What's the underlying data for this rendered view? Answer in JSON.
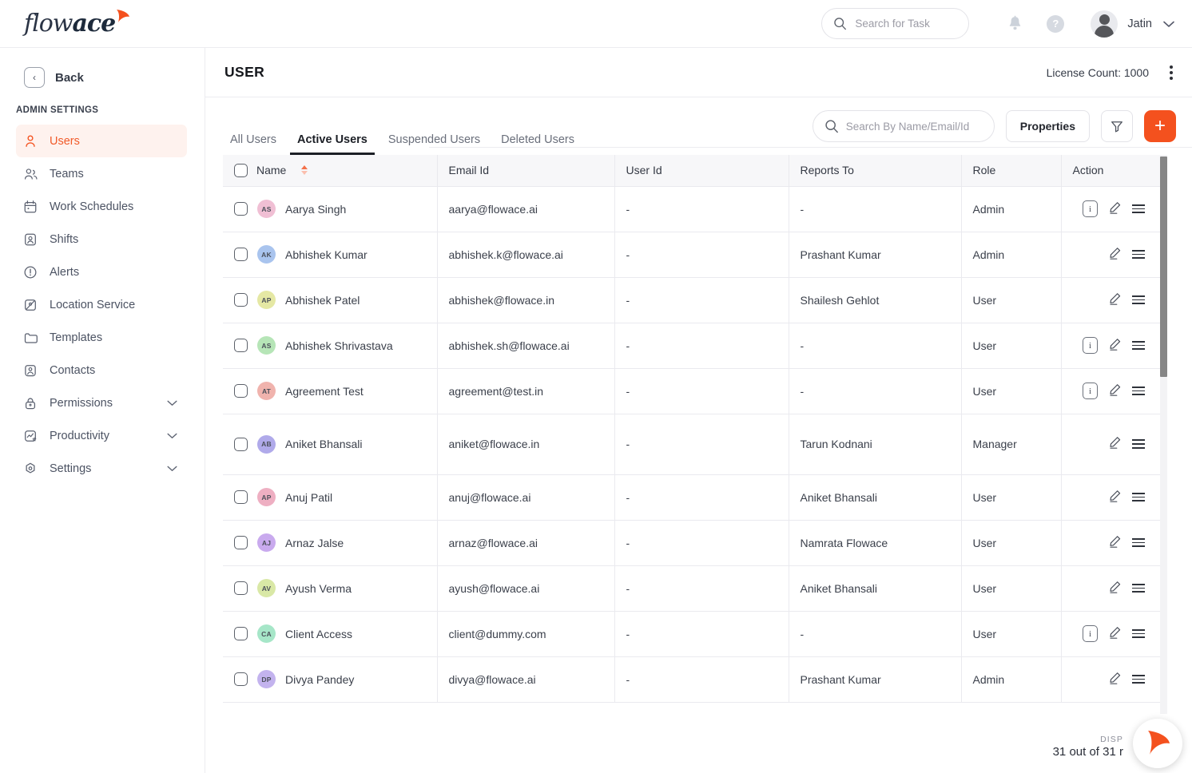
{
  "header": {
    "logo_flow": "flow",
    "logo_ace": "ace",
    "search_placeholder": "Search for Task",
    "help_label": "?",
    "user_name": "Jatin",
    "chevron": "⌄"
  },
  "sidebar": {
    "back_label": "Back",
    "back_icon": "‹",
    "section_title": "ADMIN SETTINGS",
    "items": [
      {
        "label": "Users",
        "icon": "user-icon",
        "active": true,
        "caret": ""
      },
      {
        "label": "Teams",
        "icon": "users-group-icon",
        "active": false,
        "caret": ""
      },
      {
        "label": "Work Schedules",
        "icon": "calendar-icon",
        "active": false,
        "caret": ""
      },
      {
        "label": "Shifts",
        "icon": "id-card-icon",
        "active": false,
        "caret": ""
      },
      {
        "label": "Alerts",
        "icon": "alert-circle-icon",
        "active": false,
        "caret": ""
      },
      {
        "label": "Location Service",
        "icon": "location-icon",
        "active": false,
        "caret": ""
      },
      {
        "label": "Templates",
        "icon": "folder-icon",
        "active": false,
        "caret": ""
      },
      {
        "label": "Contacts",
        "icon": "contact-icon",
        "active": false,
        "caret": ""
      },
      {
        "label": "Permissions",
        "icon": "lock-icon",
        "active": false,
        "caret": "⌄"
      },
      {
        "label": "Productivity",
        "icon": "chart-star-icon",
        "active": false,
        "caret": "⌄"
      },
      {
        "label": "Settings",
        "icon": "gear-icon",
        "active": false,
        "caret": "⌄"
      }
    ]
  },
  "page": {
    "title": "USER",
    "license_count": "License Count: 1000"
  },
  "tabs": [
    {
      "label": "All Users",
      "active": false
    },
    {
      "label": "Active Users",
      "active": true
    },
    {
      "label": "Suspended Users",
      "active": false
    },
    {
      "label": "Deleted Users",
      "active": false
    }
  ],
  "toolbar": {
    "search_placeholder": "Search By Name/Email/Id",
    "properties_label": "Properties",
    "filter_icon": "funnel-icon",
    "add_label": "+"
  },
  "table": {
    "columns": [
      "Name",
      "Email Id",
      "User Id",
      "Reports To",
      "Role",
      "Action"
    ],
    "sort_column": "Name",
    "rows": [
      {
        "initials": "AS",
        "color": "#f0bfd4",
        "name": "Aarya Singh",
        "email": "aarya@flowace.ai",
        "user_id": "-",
        "reports_to": "-",
        "role": "Admin",
        "has_info": true,
        "tall": false
      },
      {
        "initials": "AK",
        "color": "#a9c4ee",
        "name": "Abhishek Kumar",
        "email": "abhishek.k@flowace.ai",
        "user_id": "-",
        "reports_to": "Prashant Kumar",
        "role": "Admin",
        "has_info": false,
        "tall": false
      },
      {
        "initials": "AP",
        "color": "#e5e8a4",
        "name": "Abhishek Patel",
        "email": "abhishek@flowace.in",
        "user_id": "-",
        "reports_to": "Shailesh Gehlot",
        "role": "User",
        "has_info": false,
        "tall": false
      },
      {
        "initials": "AS",
        "color": "#b6e5b7",
        "name": "Abhishek Shrivastava",
        "email": "abhishek.sh@flowace.ai",
        "user_id": "-",
        "reports_to": "-",
        "role": "User",
        "has_info": true,
        "tall": false
      },
      {
        "initials": "AT",
        "color": "#f0b3ad",
        "name": "Agreement Test",
        "email": "agreement@test.in",
        "user_id": "-",
        "reports_to": "-",
        "role": "User",
        "has_info": true,
        "tall": false
      },
      {
        "initials": "AB",
        "color": "#b0aaea",
        "name": "Aniket Bhansali",
        "email": "aniket@flowace.in",
        "user_id": "-",
        "reports_to": "Tarun Kodnani",
        "role": "Manager",
        "has_info": false,
        "tall": true
      },
      {
        "initials": "AP",
        "color": "#eeafc2",
        "name": "Anuj Patil",
        "email": "anuj@flowace.ai",
        "user_id": "-",
        "reports_to": "Aniket Bhansali",
        "role": "User",
        "has_info": false,
        "tall": false
      },
      {
        "initials": "AJ",
        "color": "#c9aaee",
        "name": "Arnaz Jalse",
        "email": "arnaz@flowace.ai",
        "user_id": "-",
        "reports_to": "Namrata Flowace",
        "role": "User",
        "has_info": false,
        "tall": false
      },
      {
        "initials": "AV",
        "color": "#d9e8a6",
        "name": "Ayush Verma",
        "email": "ayush@flowace.ai",
        "user_id": "-",
        "reports_to": "Aniket Bhansali",
        "role": "User",
        "has_info": false,
        "tall": false
      },
      {
        "initials": "CA",
        "color": "#a6e6c8",
        "name": "Client Access",
        "email": "client@dummy.com",
        "user_id": "-",
        "reports_to": "-",
        "role": "User",
        "has_info": true,
        "tall": false
      },
      {
        "initials": "DP",
        "color": "#c3b3ee",
        "name": "Divya Pandey",
        "email": "divya@flowace.ai",
        "user_id": "-",
        "reports_to": "Prashant Kumar",
        "role": "Admin",
        "has_info": false,
        "tall": false
      }
    ]
  },
  "footer": {
    "displaying_label": "DISP",
    "displaying_count": "31 out of 31 r"
  },
  "colors": {
    "accent": "#f4511e",
    "accent_soft": "#fef2ee",
    "text": "#363b47",
    "muted": "#9b9ba5",
    "border": "#ececf0"
  }
}
